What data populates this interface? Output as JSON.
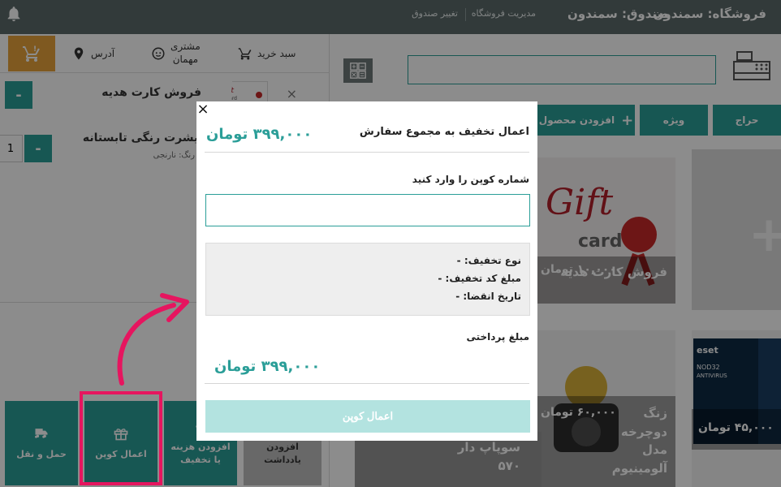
{
  "topbar": {
    "store": "فروشگاه: سمندون",
    "till": "صندوق: سمندون",
    "manage_link": "مدیریت فروشگاه",
    "change_till_link": "تغییر صندوق",
    "bell_icon": "bell-icon"
  },
  "cart": {
    "tabs": {
      "basket": "سبد خرید",
      "customer_line1": "مشتری",
      "customer_line2": "مهمان",
      "address": "آدرس"
    },
    "items": [
      {
        "name": "فروش کارت هدیه",
        "qty_symbol": "-",
        "remove": "×"
      },
      {
        "name": "بیشرت رنگی تابستانه",
        "variant": "رنگ: نارنجی",
        "qty_symbol": "-",
        "qty": "1"
      }
    ],
    "bottom_buttons": {
      "shipping": "حمل و نقل",
      "coupon": "اعمال کوپن",
      "add_cost_line1": "افزودن هزینه",
      "add_cost_line2": "یا تخفیف",
      "note_line1": "افزودن",
      "note_line2": "یادداشت"
    }
  },
  "products": {
    "categories": {
      "sale": "حراج",
      "special": "ویژه",
      "add_product": "افزودن محصول"
    },
    "cards": [
      {
        "name": "فروش کارت هدیه",
        "price": "۱۰,۰۰۰ تومان",
        "image_text_1": "Gift",
        "image_text_2": "card"
      },
      {
        "name_line1": "زنگ",
        "name_line2": "دوچرخه",
        "name_line3": "مدل",
        "name_line4": "آلومینیوم",
        "price": "۶۰,۰۰۰ تومان"
      },
      {
        "name_line1": "سوپاپ دار",
        "name_line2": "۵۷۰"
      },
      {
        "price": "۴۵,۰۰۰ تومان",
        "brand": "eset",
        "product": "NOD32",
        "sub": "ANTIVIRUS"
      }
    ]
  },
  "modal": {
    "close": "×",
    "title": "اعمال تخفیف به مجموع سفارش",
    "total": "۳۹۹,۰۰۰ تومان",
    "coupon_label": "شماره کوپن را وارد کنید",
    "coupon_value": "",
    "discount_type": "نوع تخفیف: -",
    "discount_amount": "مبلغ کد تخفیف: -",
    "expiry": "تاریخ انقضا: -",
    "pay_label": "مبلغ پرداختی",
    "pay_amount": "۳۹۹,۰۰۰ تومان",
    "apply_button": "اعمال کوپن"
  },
  "colors": {
    "teal": "#2b9e98",
    "topbar": "#5c6b6b",
    "highlight": "#e6155f",
    "disabled_button": "#b3e3e0"
  }
}
